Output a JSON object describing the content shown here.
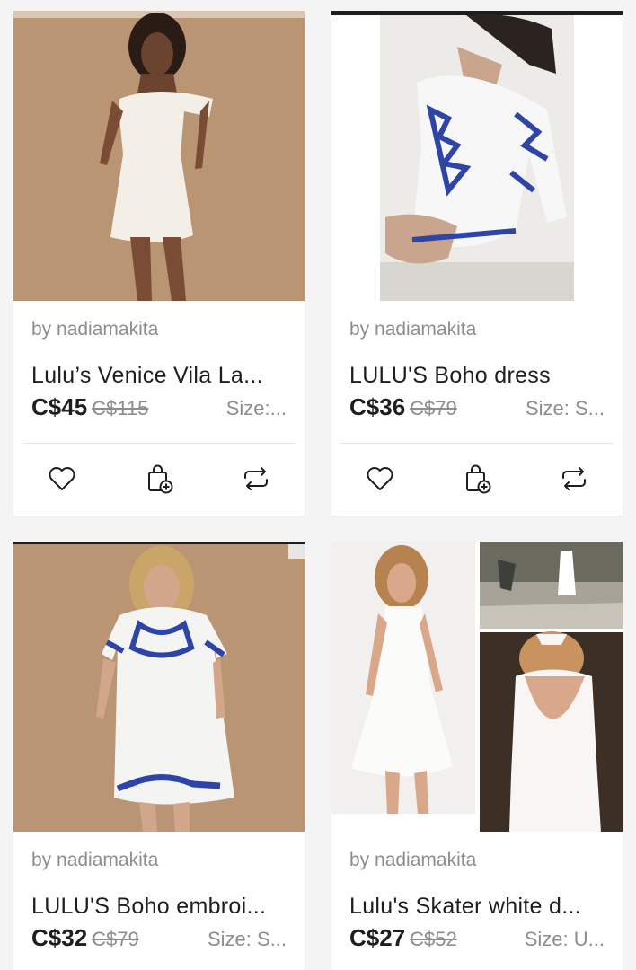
{
  "listings": [
    {
      "seller": "by nadiamakita",
      "title": "Lulu’s Venice Vila La...",
      "price": "C$45",
      "original_price": "C$115",
      "size": "Size:..."
    },
    {
      "seller": "by nadiamakita",
      "title": "LULU'S Boho dress",
      "price": "C$36",
      "original_price": "C$79",
      "size": "Size: S..."
    },
    {
      "seller": "by nadiamakita",
      "title": "LULU'S Boho embroi...",
      "price": "C$32",
      "original_price": "C$79",
      "size": "Size: S..."
    },
    {
      "seller": "by nadiamakita",
      "title": "Lulu's Skater white d...",
      "price": "C$27",
      "original_price": "C$52",
      "size": "Size: U..."
    }
  ],
  "icons": {
    "like": "heart-icon",
    "bundle": "bag-plus-icon",
    "share": "repost-icon"
  },
  "colors": {
    "text": "#1e1e1e",
    "muted": "#8d8d8d",
    "background": "#f4f4f4"
  }
}
